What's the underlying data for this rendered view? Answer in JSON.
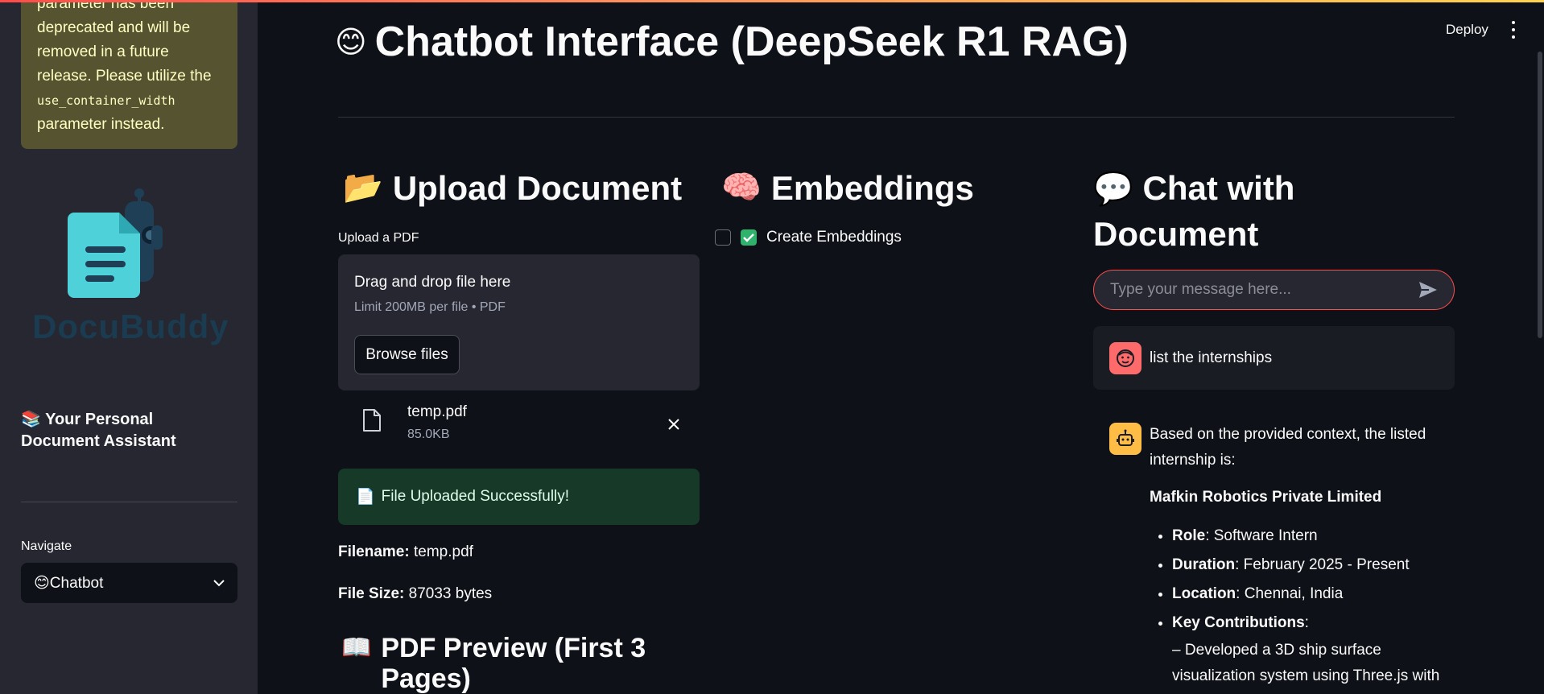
{
  "sidebar": {
    "warning_text_1": "parameter has been deprecated and will be removed in a future release. Please utilize the",
    "warning_code": "use_container_width",
    "warning_text_2": "parameter instead.",
    "logo_text": "DocuBuddy",
    "tagline": "📚 Your Personal Document Assistant",
    "nav_label": "Navigate",
    "nav_selected": "😊Chatbot"
  },
  "header": {
    "deploy_label": "Deploy",
    "title": "Chatbot Interface (DeepSeek R1 RAG)",
    "title_emoji": "😊"
  },
  "upload": {
    "heading": "Upload Document",
    "heading_emoji": "📂",
    "label": "Upload a PDF",
    "dropzone_title": "Drag and drop file here",
    "dropzone_limit": "Limit 200MB per file • PDF",
    "browse_label": "Browse files",
    "file_name": "temp.pdf",
    "file_size": "85.0KB",
    "success_icon": "📄",
    "success_text": "File Uploaded Successfully!",
    "filename_label": "Filename:",
    "filename_value": "temp.pdf",
    "filesize_label": "File Size:",
    "filesize_value": "87033 bytes",
    "preview_heading": "PDF Preview (First 3 Pages)",
    "preview_emoji": "📖"
  },
  "embeddings": {
    "heading": "Embeddings",
    "heading_emoji": "🧠",
    "checkbox_label": "Create Embeddings",
    "checked": true
  },
  "chat": {
    "heading": "Chat with Document",
    "heading_emoji": "💬",
    "input_placeholder": "Type your message here...",
    "user_message": "list the internships",
    "assistant_intro": "Based on the provided context, the listed internship is:",
    "company": "Mafkin Robotics Private Limited",
    "details": [
      {
        "label": "Role",
        "value": ": Software Intern"
      },
      {
        "label": "Duration",
        "value": ": February 2025 - Present"
      },
      {
        "label": "Location",
        "value": ": Chennai, India"
      },
      {
        "label": "Key Contributions",
        "value": ":"
      }
    ],
    "contribution_1": "– Developed a 3D ship surface visualization system using Three.js with"
  },
  "colors": {
    "accent": "#ff4b4b",
    "success_bg": "#173928",
    "warning_bg": "#565331",
    "sidebar_bg": "#262730",
    "main_bg": "#0e1117"
  }
}
